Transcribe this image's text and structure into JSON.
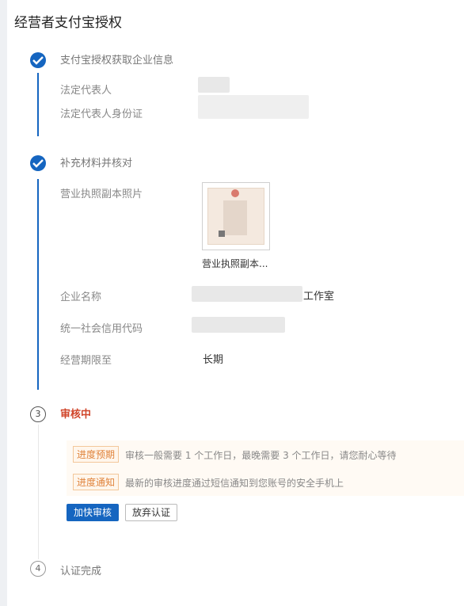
{
  "page": {
    "title": "经营者支付宝授权"
  },
  "steps": [
    {
      "index": "1",
      "title": "支付宝授权获取企业信息",
      "status": "done",
      "fields": [
        {
          "label": "法定代表人",
          "value": ""
        },
        {
          "label": "法定代表人身份证",
          "value": ""
        }
      ]
    },
    {
      "index": "2",
      "title": "补充材料并核对",
      "status": "done",
      "photo": {
        "label": "营业执照副本照片",
        "caption": "营业执照副本..."
      },
      "fields": [
        {
          "label": "企业名称",
          "value": "工作室"
        },
        {
          "label": "统一社会信用代码",
          "value": ""
        },
        {
          "label": "经营期限至",
          "value": "长期"
        }
      ]
    },
    {
      "index": "3",
      "title": "审核中",
      "status": "current",
      "notices": [
        {
          "tag": "进度预期",
          "text": "审核一般需要 1 个工作日，最晚需要 3 个工作日，请您耐心等待"
        },
        {
          "tag": "进度通知",
          "text": "最新的审核进度通过短信通知到您账号的安全手机上"
        }
      ],
      "buttons": {
        "primary": "加快审核",
        "secondary": "放弃认证"
      }
    },
    {
      "index": "4",
      "title": "认证完成",
      "status": "pending"
    }
  ],
  "colors": {
    "primary": "#1565c0",
    "active": "#d0452a",
    "tag": "#e0833b"
  },
  "icons": {
    "done": "check-icon"
  }
}
